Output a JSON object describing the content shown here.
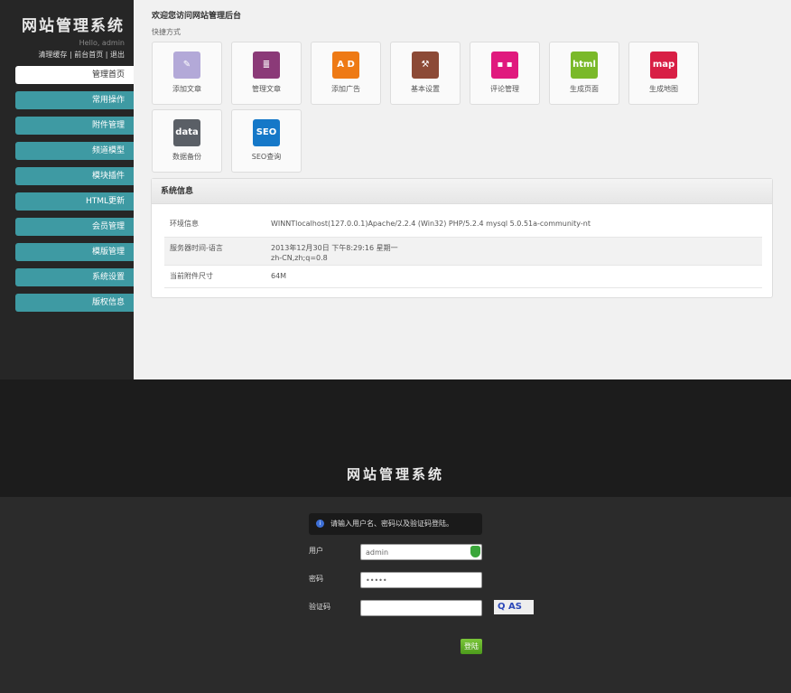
{
  "admin": {
    "brand": "网站管理系统",
    "greeting": "Hello, admin",
    "top_links": [
      "清理缓存",
      "前台首页",
      "退出"
    ],
    "nav": [
      "管理首页",
      "常用操作",
      "附件管理",
      "频道模型",
      "模块插件",
      "HTML更新",
      "会员管理",
      "模版管理",
      "系统设置",
      "版权信息"
    ],
    "welcome": "欢迎您访问网站管理后台",
    "shortcuts_title": "快捷方式",
    "shortcuts": [
      {
        "label": "添加文章",
        "icon": "pencil-icon",
        "glyph": "✎",
        "color": "#b3a9d8"
      },
      {
        "label": "管理文章",
        "icon": "stack-icon",
        "glyph": "≣",
        "color": "#8b3a78"
      },
      {
        "label": "添加广告",
        "icon": "ad-icon",
        "glyph": "A D",
        "color": "#ee7a14"
      },
      {
        "label": "基本设置",
        "icon": "hammer-icon",
        "glyph": "⚒",
        "color": "#8c4a36"
      },
      {
        "label": "评论管理",
        "icon": "comment-icon",
        "glyph": "▪ ▪",
        "color": "#e0197e"
      },
      {
        "label": "生成页面",
        "icon": "html-icon",
        "glyph": "html",
        "color": "#7ab929"
      },
      {
        "label": "生成地图",
        "icon": "map-icon",
        "glyph": "map",
        "color": "#d81f45"
      },
      {
        "label": "数据备份",
        "icon": "data-icon",
        "glyph": "data",
        "color": "#5a5f66"
      },
      {
        "label": "SEO查询",
        "icon": "seo-icon",
        "glyph": "SEO",
        "color": "#1578c8"
      }
    ],
    "sysinfo": {
      "title": "系统信息",
      "rows": [
        {
          "k": "环境信息",
          "v": "WINNTlocalhost(127.0.0.1)Apache/2.2.4 (Win32) PHP/5.2.4 mysql 5.0.51a-community-nt"
        },
        {
          "k": "服务器时间-语言",
          "v": "2013年12月30日 下午8:29:16 星期一",
          "v2": "zh-CN,zh;q=0.8"
        },
        {
          "k": "当前附件尺寸",
          "v": "64M"
        }
      ]
    }
  },
  "login": {
    "title": "网站管理系统",
    "notice": "请输入用户名、密码以及验证码登陆。",
    "user_label": "用户",
    "user_value": "admin",
    "pass_label": "密码",
    "pass_value": "•••••",
    "captcha_label": "验证码",
    "captcha_text": "Q AS",
    "submit": "登陆"
  }
}
